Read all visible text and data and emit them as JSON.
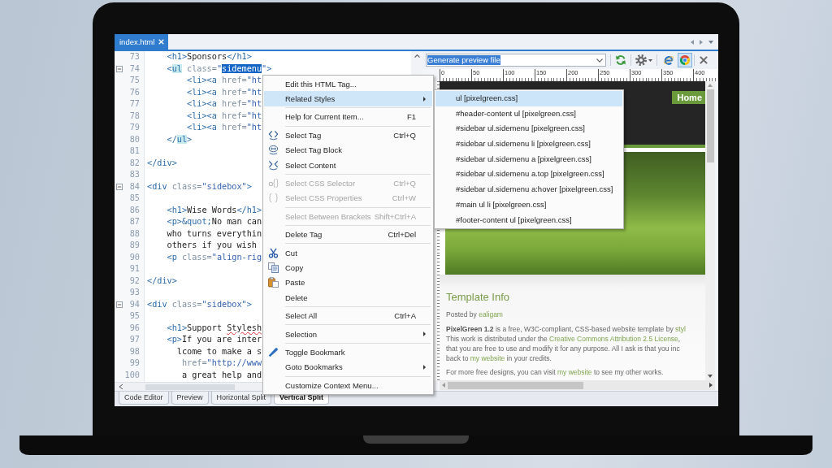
{
  "tabs": [
    {
      "label": "index.html",
      "selected": true
    }
  ],
  "code_editor": {
    "lines": [
      {
        "number": "73",
        "collapsible": false,
        "tokens": [
          {
            "text": "    <h1>",
            "kind": "tag"
          },
          {
            "text": "Sponsors",
            "kind": "text"
          },
          {
            "text": "</h1>",
            "kind": "tag"
          }
        ]
      },
      {
        "number": "74",
        "collapsible": true,
        "tokens": [
          {
            "text": "    <",
            "kind": "tag"
          },
          {
            "text": "ul",
            "kind": "tag-match"
          },
          {
            "text": " class=",
            "kind": "attr"
          },
          {
            "text": "\"",
            "kind": "value"
          },
          {
            "text": "sidemenu",
            "kind": "selection"
          },
          {
            "text": "\"",
            "kind": "value"
          },
          {
            "text": ">",
            "kind": "tag"
          }
        ]
      },
      {
        "number": "75",
        "collapsible": false,
        "tokens": [
          {
            "text": "        <li><a",
            "kind": "tag"
          },
          {
            "text": " href=",
            "kind": "attr"
          },
          {
            "text": "\"ht",
            "kind": "value"
          }
        ]
      },
      {
        "number": "76",
        "collapsible": false,
        "tokens": [
          {
            "text": "        <li><a",
            "kind": "tag"
          },
          {
            "text": " href=",
            "kind": "attr"
          },
          {
            "text": "\"ht",
            "kind": "value"
          }
        ]
      },
      {
        "number": "77",
        "collapsible": false,
        "tokens": [
          {
            "text": "        <li><a",
            "kind": "tag"
          },
          {
            "text": " href=",
            "kind": "attr"
          },
          {
            "text": "\"ht",
            "kind": "value"
          }
        ]
      },
      {
        "number": "78",
        "collapsible": false,
        "tokens": [
          {
            "text": "        <li><a",
            "kind": "tag"
          },
          {
            "text": " href=",
            "kind": "attr"
          },
          {
            "text": "\"ht",
            "kind": "value"
          }
        ]
      },
      {
        "number": "79",
        "collapsible": false,
        "tokens": [
          {
            "text": "        <li><a",
            "kind": "tag"
          },
          {
            "text": " href=",
            "kind": "attr"
          },
          {
            "text": "\"ht",
            "kind": "value"
          }
        ]
      },
      {
        "number": "80",
        "collapsible": false,
        "tokens": [
          {
            "text": "    </",
            "kind": "tag"
          },
          {
            "text": "ul",
            "kind": "tag-match"
          },
          {
            "text": ">",
            "kind": "tag"
          }
        ]
      },
      {
        "number": "81",
        "collapsible": false
      },
      {
        "number": "82",
        "collapsible": false,
        "tokens": [
          {
            "text": "</div>",
            "kind": "tag"
          }
        ]
      },
      {
        "number": "83",
        "collapsible": false
      },
      {
        "number": "84",
        "collapsible": true,
        "tokens": [
          {
            "text": "<div",
            "kind": "tag"
          },
          {
            "text": " class=",
            "kind": "attr"
          },
          {
            "text": "\"sidebox\"",
            "kind": "value"
          },
          {
            "text": ">",
            "kind": "tag"
          }
        ]
      },
      {
        "number": "85",
        "collapsible": false
      },
      {
        "number": "86",
        "collapsible": false,
        "tokens": [
          {
            "text": "    <h1>",
            "kind": "tag"
          },
          {
            "text": "Wise Words",
            "kind": "text"
          },
          {
            "text": "</h1>",
            "kind": "tag"
          }
        ]
      },
      {
        "number": "87",
        "collapsible": false,
        "tokens": [
          {
            "text": "    <p>",
            "kind": "tag"
          },
          {
            "text": "&quot;",
            "kind": "entity"
          },
          {
            "text": "No man can",
            "kind": "text"
          }
        ]
      },
      {
        "number": "88",
        "collapsible": false,
        "tokens": [
          {
            "text": "    who turns everythin",
            "kind": "text"
          }
        ]
      },
      {
        "number": "89",
        "collapsible": false,
        "tokens": [
          {
            "text": "    others if you wish",
            "kind": "text"
          }
        ]
      },
      {
        "number": "90",
        "collapsible": false,
        "tokens": [
          {
            "text": "    <p",
            "kind": "tag"
          },
          {
            "text": " class=",
            "kind": "attr"
          },
          {
            "text": "\"align-rig",
            "kind": "value"
          }
        ]
      },
      {
        "number": "91",
        "collapsible": false
      },
      {
        "number": "92",
        "collapsible": false,
        "tokens": [
          {
            "text": "</div>",
            "kind": "tag"
          }
        ]
      },
      {
        "number": "93",
        "collapsible": false
      },
      {
        "number": "94",
        "collapsible": true,
        "tokens": [
          {
            "text": "<div",
            "kind": "tag"
          },
          {
            "text": " class=",
            "kind": "attr"
          },
          {
            "text": "\"sidebox\"",
            "kind": "value"
          },
          {
            "text": ">",
            "kind": "tag"
          }
        ]
      },
      {
        "number": "95",
        "collapsible": false
      },
      {
        "number": "96",
        "collapsible": false,
        "tokens": [
          {
            "text": "    <h1>",
            "kind": "tag"
          },
          {
            "text": "Support ",
            "kind": "text"
          },
          {
            "text": "Stylesh",
            "kind": "misspelled"
          }
        ]
      },
      {
        "number": "97",
        "collapsible": false,
        "tokens": [
          {
            "text": "    <p>",
            "kind": "tag"
          },
          {
            "text": "If you are inter",
            "kind": "text"
          }
        ]
      },
      {
        "number": "98",
        "collapsible": false,
        "tokens": [
          {
            "text": "      lcome to make a s",
            "kind": "text"
          }
        ]
      },
      {
        "number": "99",
        "collapsible": false,
        "tokens": [
          {
            "text": "       href=",
            "kind": "attr"
          },
          {
            "text": "\"http://www",
            "kind": "value"
          }
        ]
      },
      {
        "number": "100",
        "collapsible": false,
        "tokens": [
          {
            "text": "       a great help and",
            "kind": "text"
          }
        ]
      }
    ]
  },
  "view_tabs": [
    {
      "label": "Code Editor",
      "selected": false
    },
    {
      "label": "Preview",
      "selected": false
    },
    {
      "label": "Horizontal Split",
      "selected": false
    },
    {
      "label": "Vertical Split",
      "selected": true
    }
  ],
  "preview": {
    "file_box": {
      "value": "Generate preview file",
      "text_selected": true
    },
    "browsers": [
      {
        "selected": false
      },
      {
        "selected": true
      }
    ],
    "ruler": [
      "0",
      "50",
      "100",
      "150",
      "200",
      "250",
      "300",
      "350",
      "400"
    ],
    "site": {
      "nav": [
        "Home"
      ],
      "heading": "Template Info",
      "byline": [
        {
          "text": "Posted by ",
          "kind": "text"
        },
        {
          "text": "ealigam",
          "kind": "link"
        }
      ],
      "paragraphs": [
        {
          "lines": [
            [
              {
                "text": "PixelGreen 1.2",
                "kind": "bold"
              },
              {
                "text": " is a free, W3C-compliant, CSS-based website template by ",
                "kind": "text"
              },
              {
                "text": "styl",
                "kind": "link"
              }
            ],
            [
              {
                "text": "This work is distributed under the ",
                "kind": "text"
              },
              {
                "text": "Creative Commons Attribution 2.5 License",
                "kind": "link"
              },
              {
                "text": ",",
                "kind": "text"
              }
            ],
            [
              {
                "text": "that you are free to use and modify it for any purpose. All I ask is that you inc",
                "kind": "text"
              }
            ],
            [
              {
                "text": "back to ",
                "kind": "text"
              },
              {
                "text": "my website",
                "kind": "link"
              },
              {
                "text": " in your credits.",
                "kind": "text"
              }
            ]
          ]
        },
        {
          "lines": [
            [
              {
                "text": "For more free designs, you can visit ",
                "kind": "text"
              },
              {
                "text": "my website",
                "kind": "link"
              },
              {
                "text": " to see my other works.",
                "kind": "text"
              }
            ]
          ]
        }
      ]
    }
  },
  "context_menu": {
    "groups": [
      {
        "items": [
          {
            "label": "Edit this HTML Tag...",
            "disabled": false,
            "selected": false,
            "submenu": false
          },
          {
            "label": "Related Styles",
            "disabled": false,
            "selected": true,
            "submenu": true
          }
        ]
      },
      {
        "items": [
          {
            "label": "Help for Current Item...",
            "shortcut": "F1",
            "disabled": false,
            "selected": false,
            "submenu": false
          }
        ]
      },
      {
        "items": [
          {
            "label": "Select Tag",
            "shortcut": "Ctrl+Q",
            "disabled": false,
            "selected": false,
            "submenu": false
          },
          {
            "label": "Select Tag Block",
            "disabled": false,
            "selected": false,
            "submenu": false
          },
          {
            "label": "Select Content",
            "disabled": false,
            "selected": false,
            "submenu": false
          }
        ]
      },
      {
        "items": [
          {
            "label": "Select CSS Selector",
            "shortcut": "Ctrl+Q",
            "disabled": true,
            "selected": false,
            "submenu": false
          },
          {
            "label": "Select CSS Properties",
            "shortcut": "Ctrl+W",
            "disabled": true,
            "selected": false,
            "submenu": false
          }
        ]
      },
      {
        "items": [
          {
            "label": "Select Between Brackets",
            "shortcut": "Shift+Ctrl+A",
            "disabled": true,
            "selected": false,
            "submenu": false
          }
        ]
      },
      {
        "items": [
          {
            "label": "Delete Tag",
            "shortcut": "Ctrl+Del",
            "disabled": false,
            "selected": false,
            "submenu": false
          }
        ]
      },
      {
        "items": [
          {
            "label": "Cut",
            "disabled": false,
            "selected": false,
            "submenu": false
          },
          {
            "label": "Copy",
            "disabled": false,
            "selected": false,
            "submenu": false
          },
          {
            "label": "Paste",
            "disabled": false,
            "selected": false,
            "submenu": false
          },
          {
            "label": "Delete",
            "disabled": false,
            "selected": false,
            "submenu": false
          }
        ]
      },
      {
        "items": [
          {
            "label": "Select All",
            "shortcut": "Ctrl+A",
            "disabled": false,
            "selected": false,
            "submenu": false
          }
        ]
      },
      {
        "items": [
          {
            "label": "Selection",
            "disabled": false,
            "selected": false,
            "submenu": true
          }
        ]
      },
      {
        "items": [
          {
            "label": "Toggle Bookmark",
            "disabled": false,
            "selected": false,
            "submenu": false
          },
          {
            "label": "Goto Bookmarks",
            "disabled": false,
            "selected": false,
            "submenu": true
          }
        ]
      },
      {
        "items": [
          {
            "label": "Customize Context Menu...",
            "disabled": false,
            "selected": false,
            "submenu": false
          }
        ]
      }
    ]
  },
  "submenu": {
    "items": [
      {
        "label": "ul [pixelgreen.css]",
        "selected": true
      },
      {
        "label": "#header-content ul [pixelgreen.css]",
        "selected": false
      },
      {
        "label": "#sidebar ul.sidemenu [pixelgreen.css]",
        "selected": false
      },
      {
        "label": "#sidebar ul.sidemenu li [pixelgreen.css]",
        "selected": false
      },
      {
        "label": "#sidebar ul.sidemenu a [pixelgreen.css]",
        "selected": false
      },
      {
        "label": "#sidebar ul.sidemenu a.top [pixelgreen.css]",
        "selected": false
      },
      {
        "label": "#sidebar ul.sidemenu a:hover [pixelgreen.css]",
        "selected": false
      },
      {
        "label": "#main ul li [pixelgreen.css]",
        "selected": false
      },
      {
        "label": "#footer-content ul [pixelgreen.css]",
        "selected": false
      }
    ]
  }
}
